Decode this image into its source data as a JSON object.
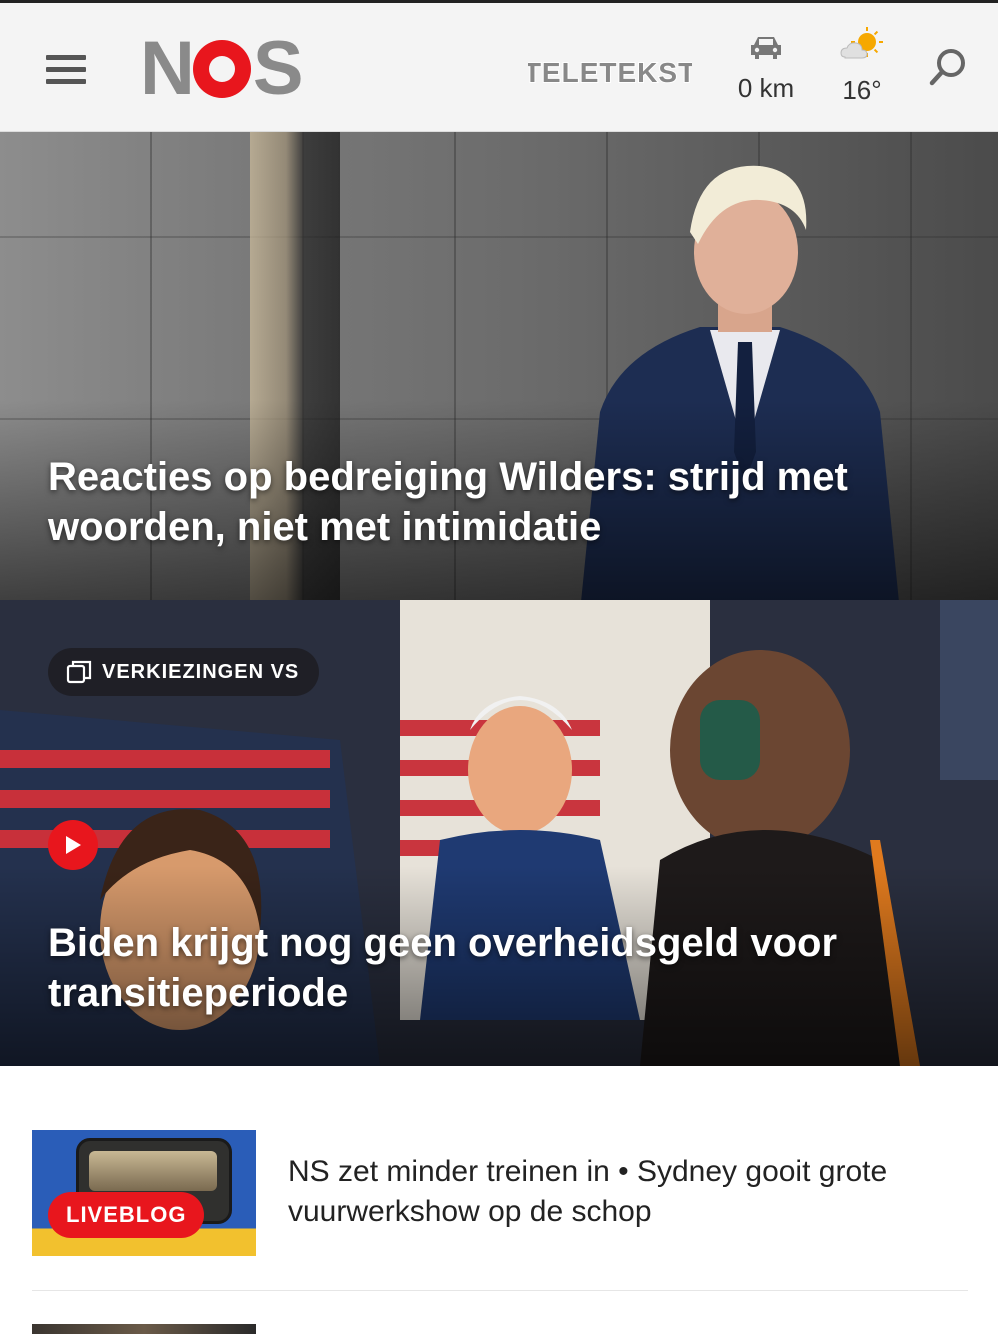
{
  "header": {
    "logo": "NOS",
    "teletekst_label": "TELETEKST",
    "traffic": {
      "value": "0 km",
      "icon": "car-icon"
    },
    "weather": {
      "value": "16°",
      "icon": "partly-sunny-icon"
    },
    "search_icon": "search-icon",
    "menu_icon": "hamburger-menu-icon"
  },
  "hero_articles": [
    {
      "title": "Reacties op bedreiging Wilders: strijd met woorden, niet met intimidatie"
    },
    {
      "title": "Biden krijgt nog geen overheidsgeld voor transitieperiode",
      "tag": "VERKIEZINGEN VS",
      "has_video": true
    }
  ],
  "list_articles": [
    {
      "badge": "LIVEBLOG",
      "title": "NS zet minder treinen in • Sydney gooit grote vuurwerkshow op de schop"
    }
  ],
  "colors": {
    "brand_red": "#e8161d",
    "header_bg": "#f4f4f4",
    "logo_gray": "#8a8a8a"
  }
}
